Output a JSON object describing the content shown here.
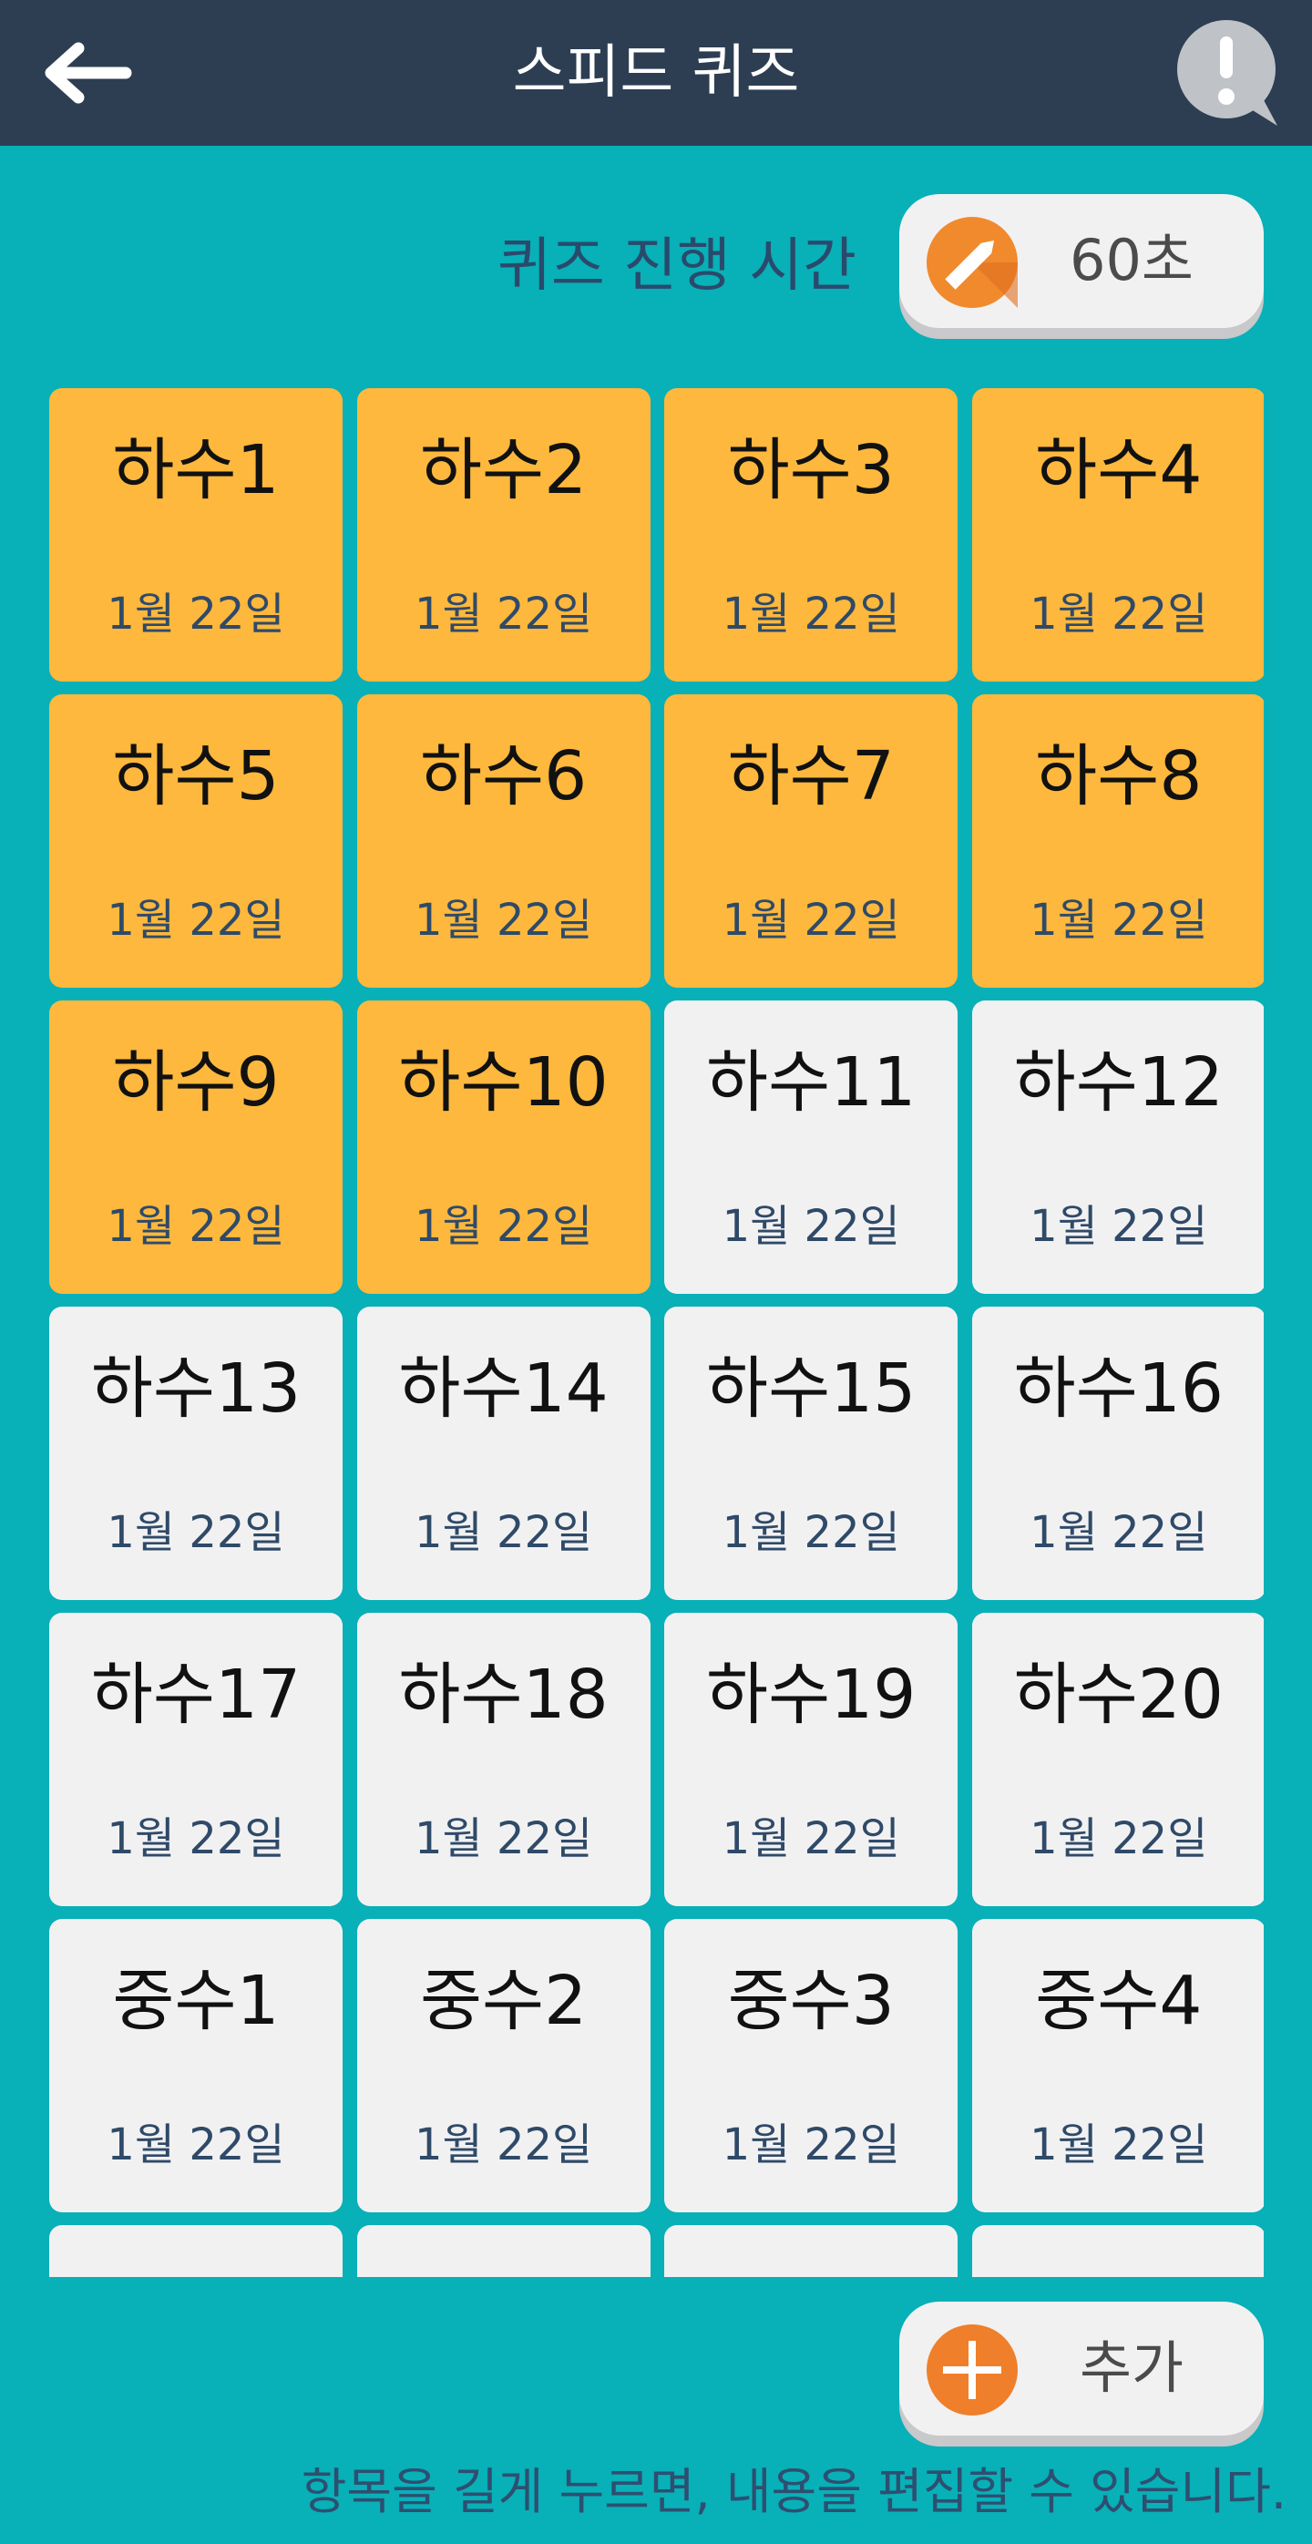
{
  "header": {
    "title": "스피드 퀴즈",
    "back_icon": "arrow-left-icon",
    "info_icon": "exclamation-bubble-icon"
  },
  "quiz_time": {
    "label": "퀴즈 진행 시간",
    "value": "60초",
    "edit_icon": "pencil-icon"
  },
  "items": [
    {
      "title": "하수1",
      "date": "1월 22일",
      "status": "done"
    },
    {
      "title": "하수2",
      "date": "1월 22일",
      "status": "done"
    },
    {
      "title": "하수3",
      "date": "1월 22일",
      "status": "done"
    },
    {
      "title": "하수4",
      "date": "1월 22일",
      "status": "done"
    },
    {
      "title": "하수5",
      "date": "1월 22일",
      "status": "done"
    },
    {
      "title": "하수6",
      "date": "1월 22일",
      "status": "done"
    },
    {
      "title": "하수7",
      "date": "1월 22일",
      "status": "done"
    },
    {
      "title": "하수8",
      "date": "1월 22일",
      "status": "done"
    },
    {
      "title": "하수9",
      "date": "1월 22일",
      "status": "done"
    },
    {
      "title": "하수10",
      "date": "1월 22일",
      "status": "done"
    },
    {
      "title": "하수11",
      "date": "1월 22일",
      "status": "pending"
    },
    {
      "title": "하수12",
      "date": "1월 22일",
      "status": "pending"
    },
    {
      "title": "하수13",
      "date": "1월 22일",
      "status": "pending"
    },
    {
      "title": "하수14",
      "date": "1월 22일",
      "status": "pending"
    },
    {
      "title": "하수15",
      "date": "1월 22일",
      "status": "pending"
    },
    {
      "title": "하수16",
      "date": "1월 22일",
      "status": "pending"
    },
    {
      "title": "하수17",
      "date": "1월 22일",
      "status": "pending"
    },
    {
      "title": "하수18",
      "date": "1월 22일",
      "status": "pending"
    },
    {
      "title": "하수19",
      "date": "1월 22일",
      "status": "pending"
    },
    {
      "title": "하수20",
      "date": "1월 22일",
      "status": "pending"
    },
    {
      "title": "중수1",
      "date": "1월 22일",
      "status": "pending"
    },
    {
      "title": "중수2",
      "date": "1월 22일",
      "status": "pending"
    },
    {
      "title": "중수3",
      "date": "1월 22일",
      "status": "pending"
    },
    {
      "title": "중수4",
      "date": "1월 22일",
      "status": "pending"
    },
    {
      "title": "",
      "date": "",
      "status": "pending"
    },
    {
      "title": "",
      "date": "",
      "status": "pending"
    },
    {
      "title": "",
      "date": "",
      "status": "pending"
    },
    {
      "title": "",
      "date": "",
      "status": "pending"
    }
  ],
  "add_button": {
    "label": "추가",
    "icon": "plus-icon"
  },
  "hint": "항목을 길게 누르면, 내용을 편집할 수 있습니다.",
  "colors": {
    "app_bar": "#2d3e52",
    "background": "#08b0b8",
    "done_card": "#fdb83d",
    "pending_card": "#f2f1f2",
    "accent": "#f08a2c"
  }
}
